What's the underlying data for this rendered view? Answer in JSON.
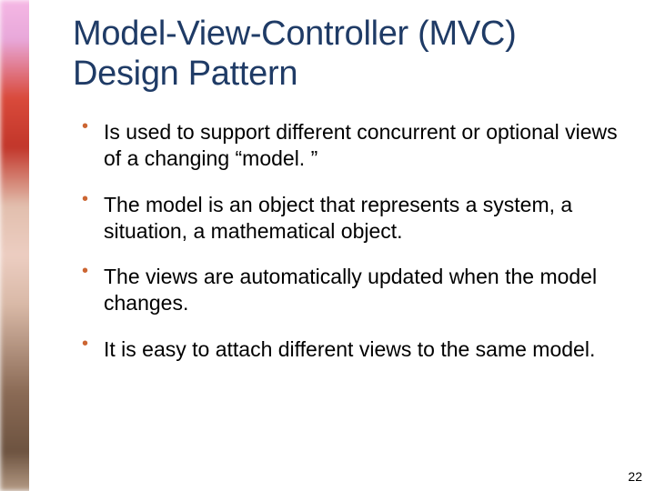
{
  "title": "Model-View-Controller (MVC) Design Pattern",
  "bullets": [
    "Is used to support different concurrent or optional views of a changing “model. ”",
    "The model is an object that represents a system, a situation, a mathematical object.",
    "The views are automatically updated when the model changes.",
    "It is easy to attach different views to the same model."
  ],
  "page_number": "22"
}
